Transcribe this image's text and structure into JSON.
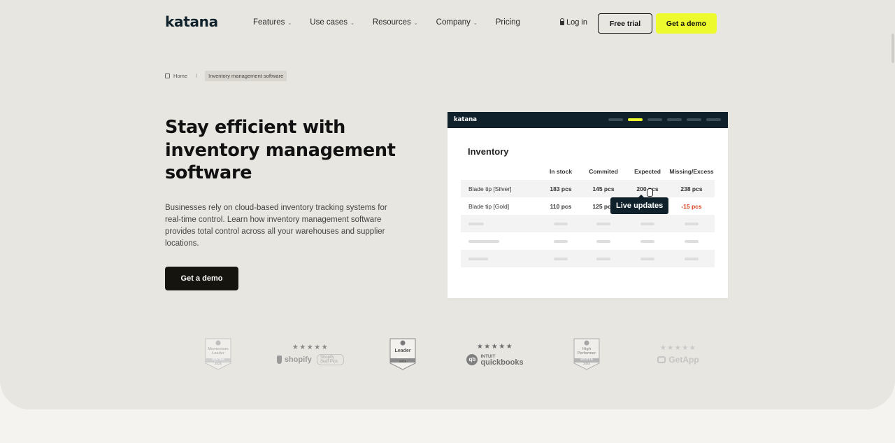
{
  "header": {
    "logo": "katana",
    "nav": [
      {
        "label": "Features",
        "has_dropdown": true
      },
      {
        "label": "Use cases",
        "has_dropdown": true
      },
      {
        "label": "Resources",
        "has_dropdown": true
      },
      {
        "label": "Company",
        "has_dropdown": true
      },
      {
        "label": "Pricing",
        "has_dropdown": false
      }
    ],
    "login": "Log in",
    "free_trial": "Free trial",
    "get_demo": "Get a demo"
  },
  "breadcrumb": {
    "home": "Home",
    "separator": "/",
    "current": "Inventory management software"
  },
  "hero": {
    "title": "Stay efficient with inventory management software",
    "description": "Businesses rely on cloud-based inventory tracking systems for real-time control. Learn how inventory management software provides total control across all your warehouses and supplier locations.",
    "cta": "Get a demo"
  },
  "mockup": {
    "logo": "katana",
    "title": "Inventory",
    "columns": [
      "In stock",
      "Commited",
      "Expected",
      "Missing/Excess"
    ],
    "rows": [
      {
        "name": "Blade tip [Silver]",
        "in_stock": "183 pcs",
        "commited": "145 pcs",
        "expected": "200 pcs",
        "missing": "238 pcs"
      },
      {
        "name": "Blade tip [Gold]",
        "in_stock": "110 pcs",
        "commited": "125 pcs",
        "expected": "",
        "missing": "-15 pcs"
      }
    ],
    "tooltip": "Live updates"
  },
  "awards": [
    {
      "type": "badge",
      "title": "Momentum Leader",
      "sub": "WINTER",
      "year": "2025"
    },
    {
      "type": "rating",
      "stars": "★★★★★",
      "brand": "shopify",
      "extra": "Shopify Staff Pick"
    },
    {
      "type": "badge",
      "title": "Leader",
      "sub": "WINTER",
      "year": "2025"
    },
    {
      "type": "rating",
      "stars": "★★★★★",
      "brand_prefix": "INTUIT",
      "brand": "quickbooks"
    },
    {
      "type": "badge",
      "title": "High Performer",
      "sub": "WINTER",
      "year": "2025"
    },
    {
      "type": "rating",
      "stars": "★★★★★",
      "brand": "GetApp"
    }
  ],
  "colors": {
    "accent": "#ecfa2e",
    "dark": "#10212b",
    "hero_bg": "#e8e6e0",
    "negative": "#d33a1a"
  }
}
